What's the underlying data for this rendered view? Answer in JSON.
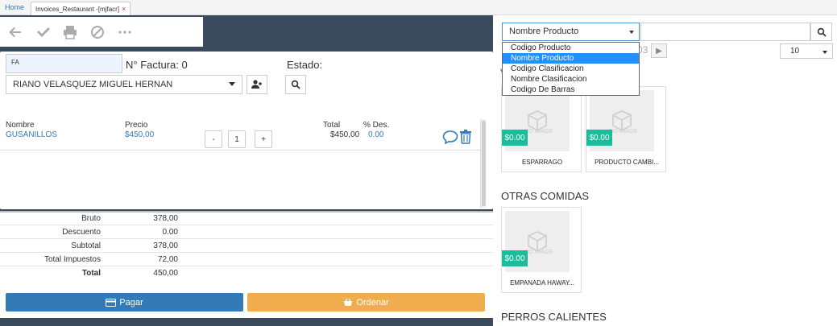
{
  "tabs": {
    "home": "Home",
    "active": "Invoices_Restaurant -[mjfacr]",
    "close": "×"
  },
  "invoice": {
    "doc_type": "FA",
    "number_label": "N° Factura: 0",
    "state_label": "Estado:",
    "client": "RIANO VELASQUEZ MIGUEL HERNAN"
  },
  "line_headers": {
    "name": "Nombre",
    "price": "Precio",
    "total": "Total",
    "discount": "% Des."
  },
  "lines": [
    {
      "name": "GUSANILLOS",
      "price": "$450,00",
      "qty": "1",
      "minus": "-",
      "plus": "+",
      "total": "$450,00",
      "discount": "0.00"
    }
  ],
  "totals": [
    {
      "label": "Bruto",
      "value": "378,00"
    },
    {
      "label": "Descuento",
      "value": "0.00"
    },
    {
      "label": "Subtotal",
      "value": "378,00"
    },
    {
      "label": "Total Impuestos",
      "value": "72,00"
    },
    {
      "label": "Total",
      "value": "450,00"
    }
  ],
  "actions": {
    "pay": "Pagar",
    "order": "Ordenar"
  },
  "search": {
    "field_selected": "Nombre Producto",
    "options": [
      "Codigo Producto",
      "Nombre Producto",
      "Codigo Clasificacion",
      "Nombre Clasificacion",
      "Codigo De Barras"
    ],
    "selected_index": 1
  },
  "pager": {
    "page_fragment": "03",
    "next": "▶",
    "per_page": "10"
  },
  "catalog_partial_char": "V",
  "products_top": [
    {
      "name": "ESPARRAGO",
      "price": "$0.00",
      "image_text": "NO IMAGE"
    },
    {
      "name": "PRODUCTO CAMBI...",
      "price": "$0.00",
      "image_text": "NO IMAGE"
    }
  ],
  "sections": [
    {
      "title": "OTRAS COMIDAS",
      "products": [
        {
          "name": "EMPANADA HAWAY...",
          "price": "$0.00",
          "image_text": "NO IMAGE"
        }
      ]
    },
    {
      "title": "PERROS CALIENTES",
      "products": []
    }
  ],
  "colors": {
    "dark_bg": "#3b4a5c",
    "primary": "#337ab7",
    "warning": "#f0ad4e",
    "price_badge": "#1abc9c",
    "selected_option": "#1e90ff"
  }
}
